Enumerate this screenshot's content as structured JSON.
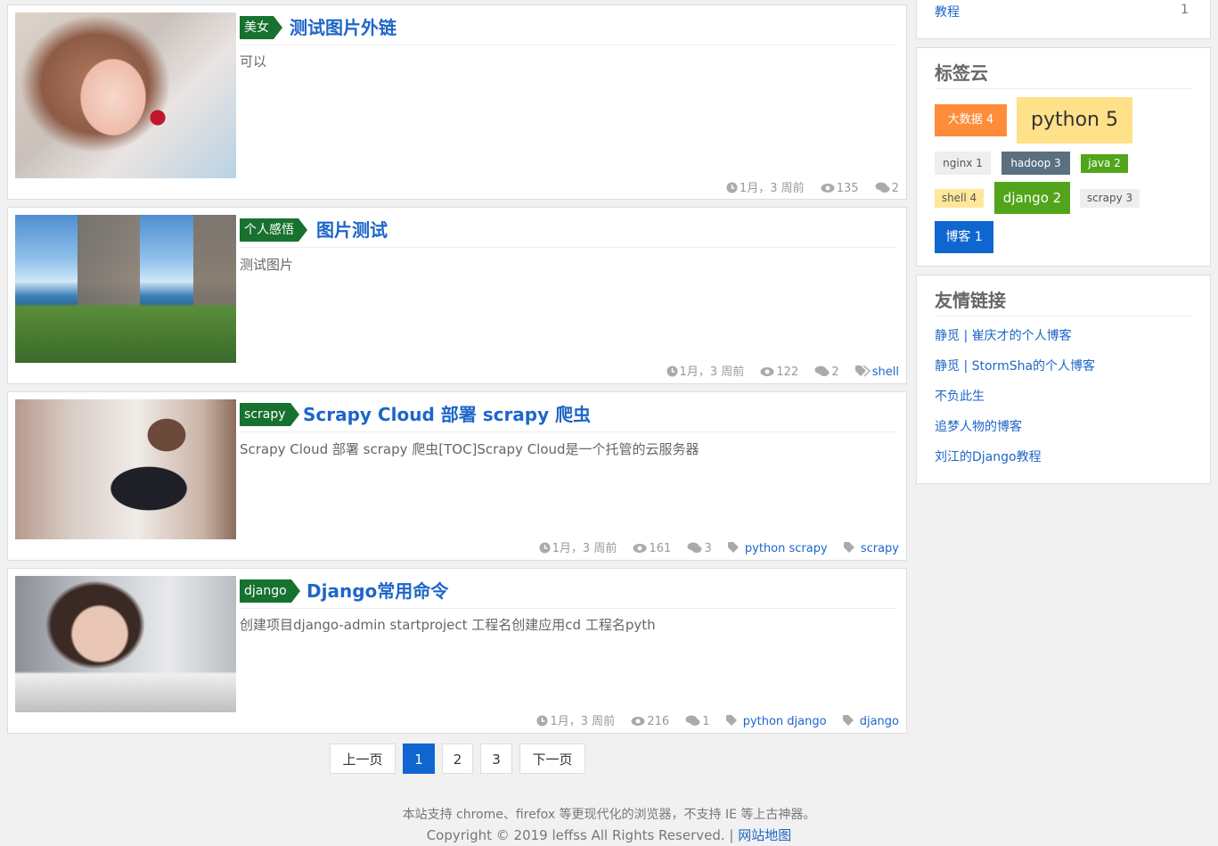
{
  "posts": [
    {
      "category": "美女",
      "title": "测试图片外链",
      "excerpt": "可以",
      "date": "1月，3 周前",
      "views": "135",
      "comments": "2",
      "tags": []
    },
    {
      "category": "个人感悟",
      "title": "图片测试",
      "excerpt": "测试图片",
      "date": "1月，3 周前",
      "views": "122",
      "comments": "2",
      "tags": [
        "shell"
      ]
    },
    {
      "category": "scrapy",
      "title": "Scrapy Cloud 部署 scrapy 爬虫",
      "excerpt": "Scrapy Cloud 部署 scrapy 爬虫[TOC]Scrapy Cloud是一个托管的云服务器",
      "date": "1月，3 周前",
      "views": "161",
      "comments": "3",
      "tags": [
        "python scrapy",
        "scrapy"
      ]
    },
    {
      "category": "django",
      "title": "Django常用命令",
      "excerpt": "创建项目django-admin startproject 工程名创建应用cd 工程名pyth",
      "date": "1月，3 周前",
      "views": "216",
      "comments": "1",
      "tags": [
        "python django",
        "django"
      ]
    }
  ],
  "sidebar": {
    "category_item": {
      "label": "教程",
      "count": "1"
    },
    "tagcloud_title": "标签云",
    "tags": [
      {
        "label": "大数据 4",
        "bg": "#ff8c3a",
        "color": "#ffffff"
      },
      {
        "label": "python 5",
        "bg": "#ffe18a",
        "color": "#333333"
      },
      {
        "label": "nginx 1",
        "bg": "#eeeeee",
        "color": "#555555"
      },
      {
        "label": "hadoop 3",
        "bg": "#5a7080",
        "color": "#ffffff"
      },
      {
        "label": "java 2",
        "bg": "#52a51a",
        "color": "#ffffff"
      },
      {
        "label": "shell 4",
        "bg": "#ffe79a",
        "color": "#555555"
      },
      {
        "label": "django 2",
        "bg": "#52a51a",
        "color": "#ffffff"
      },
      {
        "label": "scrapy 3",
        "bg": "#eeeeee",
        "color": "#555555"
      },
      {
        "label": "博客 1",
        "bg": "#0f66d0",
        "color": "#ffffff"
      }
    ],
    "links_title": "友情链接",
    "links": [
      "静觅 | 崔庆才的个人博客",
      "静觅 | StormSha的个人博客",
      "不负此生",
      "追梦人物的博客",
      "刘江的Django教程"
    ]
  },
  "pagination": {
    "prev": "上一页",
    "pages": [
      "1",
      "2",
      "3"
    ],
    "current": "1",
    "next": "下一页"
  },
  "footer": {
    "notice": "本站支持 chrome、firefox 等更现代化的浏览器，不支持 IE 等上古神器。",
    "copyright": "Copyright © 2019 leffss All Rights Reserved.",
    "separator": "|",
    "sitemap": "网站地图"
  },
  "colors": {
    "accent": "#1e66c8",
    "category_bg": "#17712f",
    "active_page": "#0f66d0"
  },
  "icons": {
    "date": "clock-icon",
    "views": "eye-icon",
    "comments": "comments-icon",
    "tag": "tag-icon"
  }
}
